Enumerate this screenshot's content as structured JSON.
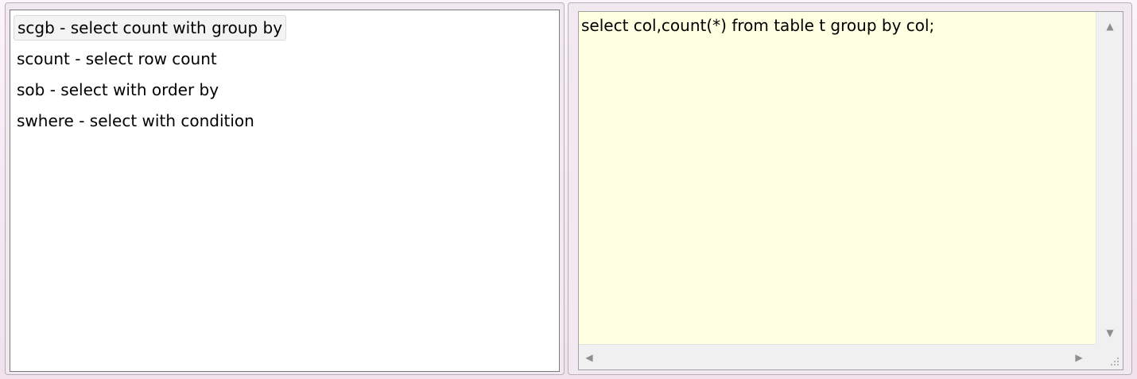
{
  "snippet_list": {
    "items": [
      {
        "label": "scgb - select count with group by",
        "selected": true
      },
      {
        "label": "scount - select row count",
        "selected": false
      },
      {
        "label": "sob - select with order by",
        "selected": false
      },
      {
        "label": "swhere - select with condition",
        "selected": false
      }
    ]
  },
  "editor": {
    "text": "select col,count(*) from table t group by col;",
    "background": "#ffffe1"
  },
  "scrollbars": {
    "up_icon": "arrow-up",
    "down_icon": "arrow-down",
    "left_icon": "arrow-left",
    "right_icon": "arrow-right",
    "grip_icon": "resize-grip"
  },
  "colors": {
    "frame": "#f7eef5",
    "selection": "#f3f3f3"
  }
}
